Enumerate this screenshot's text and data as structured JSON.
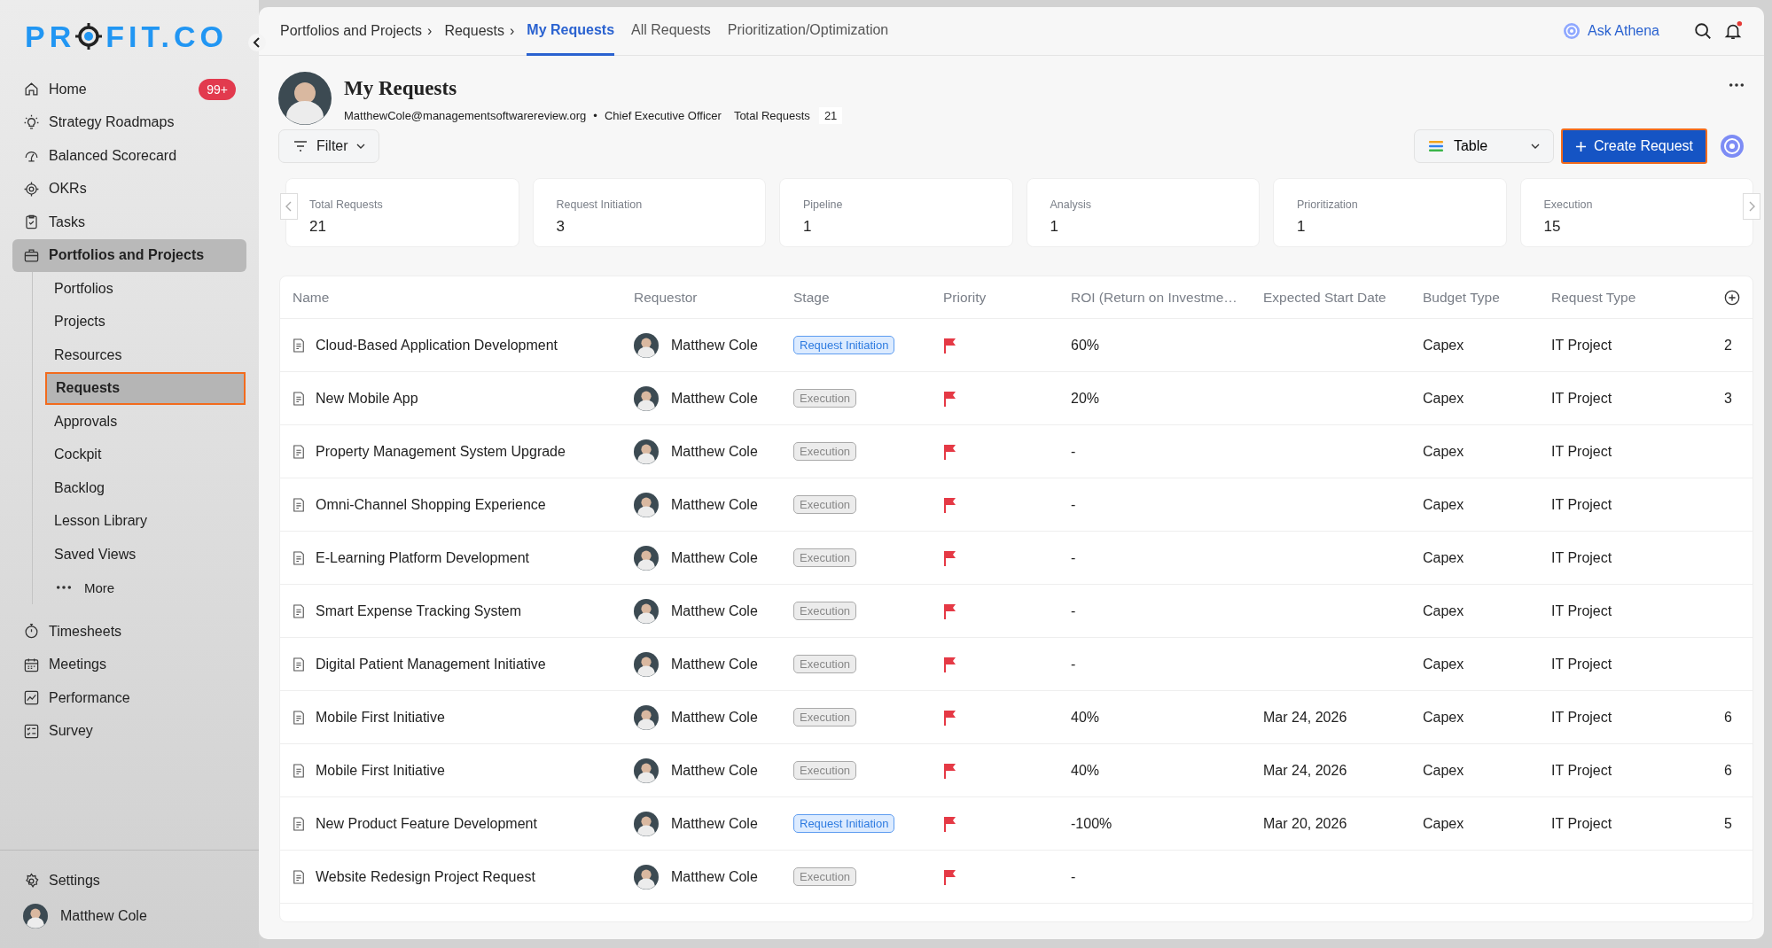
{
  "sidebar": {
    "logo_start": "PR",
    "logo_end": "FIT.CO",
    "items": [
      {
        "label": "Home",
        "kind": "home",
        "badge": "99+",
        "selected": false
      },
      {
        "label": "Strategy Roadmaps",
        "kind": "bulb",
        "selected": false
      },
      {
        "label": "Balanced Scorecard",
        "kind": "gauge",
        "selected": false
      },
      {
        "label": "OKRs",
        "kind": "target",
        "selected": false
      },
      {
        "label": "Tasks",
        "kind": "clipboard",
        "selected": false
      },
      {
        "label": "Portfolios and Projects",
        "kind": "briefcase",
        "selected": true,
        "expanded": true,
        "children": [
          {
            "label": "Portfolios",
            "kind": "link",
            "selected": false
          },
          {
            "label": "Projects",
            "kind": "link",
            "selected": false
          },
          {
            "label": "Resources",
            "kind": "link",
            "selected": false
          },
          {
            "label": "Requests",
            "kind": "link",
            "selected": true
          },
          {
            "label": "Approvals",
            "kind": "link",
            "selected": false
          },
          {
            "label": "Cockpit",
            "kind": "link",
            "selected": false
          },
          {
            "label": "Backlog",
            "kind": "link",
            "selected": false
          },
          {
            "label": "Lesson Library",
            "kind": "link",
            "selected": false
          },
          {
            "label": "Saved Views",
            "kind": "link",
            "selected": false
          },
          {
            "label": "More",
            "kind": "more",
            "selected": false
          }
        ]
      },
      {
        "label": "Timesheets",
        "kind": "timer",
        "selected": false
      },
      {
        "label": "Meetings",
        "kind": "calendar",
        "selected": false
      },
      {
        "label": "Performance",
        "kind": "chart",
        "selected": false
      },
      {
        "label": "Survey",
        "kind": "survey",
        "selected": false
      }
    ],
    "footer": [
      {
        "label": "Settings",
        "kind": "settings"
      },
      {
        "label": "Matthew Cole",
        "kind": "user"
      }
    ]
  },
  "topbar": {
    "breadcrumbs": [
      {
        "label": "Portfolios and Projects",
        "separator": "›"
      },
      {
        "label": "Requests",
        "separator": "›"
      }
    ],
    "tabs": [
      {
        "label": "My Requests",
        "selected": true
      },
      {
        "label": "All Requests",
        "selected": false
      },
      {
        "label": "Prioritization/Optimization",
        "selected": false
      }
    ],
    "assistant": "Ask Athena",
    "has_notification": true
  },
  "header": {
    "title": "My Requests",
    "email": "MatthewCole@managementsoftwarereview.org",
    "separator": "•",
    "role": "Chief Executive Officer",
    "total_label": "Total Requests",
    "total": "21"
  },
  "toolbar": {
    "filter": "Filter",
    "view": "Table",
    "create": "Create Request"
  },
  "stats": [
    {
      "label": "Total Requests",
      "value": "21"
    },
    {
      "label": "Request Initiation",
      "value": "3"
    },
    {
      "label": "Pipeline",
      "value": "1"
    },
    {
      "label": "Analysis",
      "value": "1"
    },
    {
      "label": "Prioritization",
      "value": "1"
    },
    {
      "label": "Execution",
      "value": "15"
    }
  ],
  "table": {
    "columns": [
      "Name",
      "Requestor",
      "Stage",
      "Priority",
      "ROI (Return on Investme…",
      "Expected Start Date",
      "Budget Type",
      "Request Type"
    ],
    "rows": [
      {
        "name": "Cloud-Based Application Development",
        "requestor": "Matthew Cole",
        "stage": {
          "label": "Request Initiation",
          "kind": "initiation"
        },
        "roi": "60%",
        "budget": "Capex",
        "type": "IT Project",
        "column_9": "2"
      },
      {
        "name": "New Mobile App",
        "requestor": "Matthew Cole",
        "stage": {
          "label": "Execution",
          "kind": "execution"
        },
        "roi": "20%",
        "budget": "Capex",
        "type": "IT Project",
        "column_9": "3"
      },
      {
        "name": "Property Management System Upgrade",
        "requestor": "Matthew Cole",
        "stage": {
          "label": "Execution",
          "kind": "execution"
        },
        "roi": "-",
        "budget": "Capex",
        "type": "IT Project"
      },
      {
        "name": "Omni-Channel Shopping Experience",
        "requestor": "Matthew Cole",
        "stage": {
          "label": "Execution",
          "kind": "execution"
        },
        "roi": "-",
        "budget": "Capex",
        "type": "IT Project"
      },
      {
        "name": "E-Learning Platform Development",
        "requestor": "Matthew Cole",
        "stage": {
          "label": "Execution",
          "kind": "execution"
        },
        "roi": "-",
        "budget": "Capex",
        "type": "IT Project"
      },
      {
        "name": "Smart Expense Tracking System",
        "requestor": "Matthew Cole",
        "stage": {
          "label": "Execution",
          "kind": "execution"
        },
        "roi": "-",
        "budget": "Capex",
        "type": "IT Project"
      },
      {
        "name": "Digital Patient Management Initiative",
        "requestor": "Matthew Cole",
        "stage": {
          "label": "Execution",
          "kind": "execution"
        },
        "roi": "-",
        "budget": "Capex",
        "type": "IT Project"
      },
      {
        "name": "Mobile First Initiative",
        "requestor": "Matthew Cole",
        "stage": {
          "label": "Execution",
          "kind": "execution"
        },
        "roi": "40%",
        "start": "Mar 24, 2026",
        "budget": "Capex",
        "type": "IT Project",
        "column_9": "6"
      },
      {
        "name": "Mobile First Initiative",
        "requestor": "Matthew Cole",
        "stage": {
          "label": "Execution",
          "kind": "execution"
        },
        "roi": "40%",
        "start": "Mar 24, 2026",
        "budget": "Capex",
        "type": "IT Project",
        "column_9": "6"
      },
      {
        "name": "New Product Feature Development",
        "requestor": "Matthew Cole",
        "stage": {
          "label": "Request Initiation",
          "kind": "initiation"
        },
        "roi": "-100%",
        "start": "Mar 20, 2026",
        "budget": "Capex",
        "type": "IT Project",
        "column_9": "5"
      },
      {
        "name": "Website Redesign Project Request",
        "requestor": "Matthew Cole",
        "stage": {
          "label": "Execution",
          "kind": "execution"
        },
        "roi": "-"
      }
    ]
  }
}
